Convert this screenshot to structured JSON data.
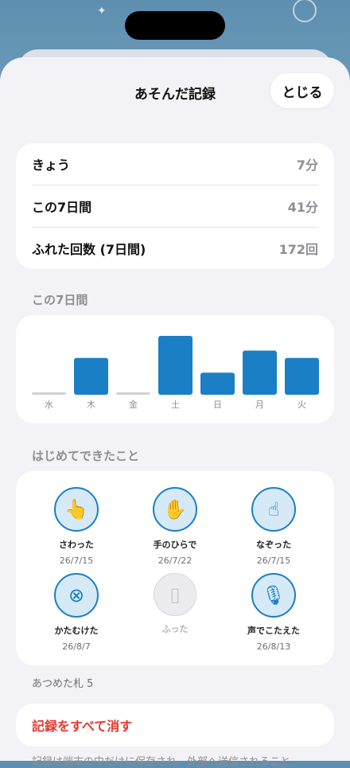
{
  "header": {
    "title": "あそんだ記録",
    "close_label": "とじる"
  },
  "stats": [
    {
      "label": "きょう",
      "value": "7分"
    },
    {
      "label": "この7日間",
      "value": "41分"
    },
    {
      "label": "ふれた回数 (7日間)",
      "value": "172回"
    }
  ],
  "week_section_title": "この7日間",
  "chart_data": {
    "type": "bar",
    "categories": [
      "水",
      "木",
      "金",
      "土",
      "日",
      "月",
      "火"
    ],
    "values": [
      0,
      5,
      0,
      8,
      3,
      6,
      5
    ],
    "color": "#1b7fc6",
    "empty_color": "#d1d1d6"
  },
  "firsts_section_title": "はじめてできたこと",
  "achievements": [
    {
      "name": "さわった",
      "date": "26/7/15",
      "icon": "tap-hand-icon",
      "unlocked": true
    },
    {
      "name": "手のひらで",
      "date": "26/7/22",
      "icon": "palm-icon",
      "unlocked": true
    },
    {
      "name": "なぞった",
      "date": "26/7/15",
      "icon": "swipe-hand-icon",
      "unlocked": true
    },
    {
      "name": "かたむけた",
      "date": "26/8/7",
      "icon": "tilt-globe-icon",
      "unlocked": true
    },
    {
      "name": "ふった",
      "date": "",
      "icon": "shake-phone-icon",
      "unlocked": false
    },
    {
      "name": "声でこたえた",
      "date": "26/8/13",
      "icon": "microphone-icon",
      "unlocked": true
    }
  ],
  "collected_note": "あつめた札 5",
  "reset_label": "記録をすべて消す",
  "privacy_note": "記録は端末の中だけに保存され、外部へ送信されること"
}
